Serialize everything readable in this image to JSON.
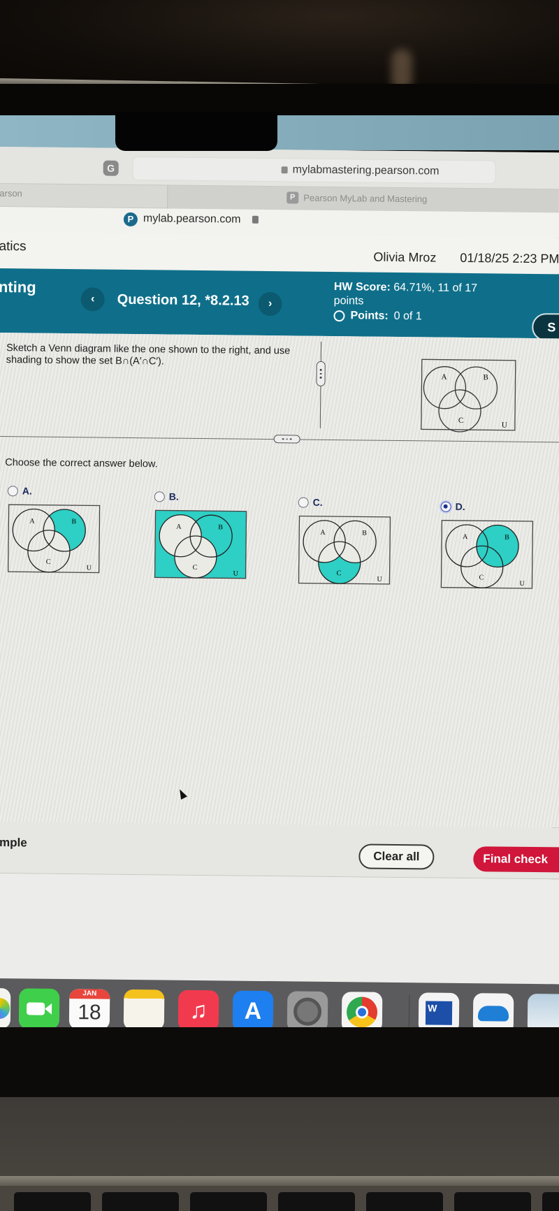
{
  "browser": {
    "address_url": "mylabmastering.pearson.com",
    "tabs": [
      {
        "label": "arson",
        "active": false
      },
      {
        "label": "Pearson MyLab and Mastering",
        "active": true,
        "favicon": "P"
      }
    ],
    "site_url": "mylab.pearson.com",
    "grammarly_icon": "G"
  },
  "header": {
    "course_fragment": "atics",
    "user_name": "Olivia Mroz",
    "timestamp": "01/18/25 2:23 PM"
  },
  "question_bar": {
    "section_fragment": "nting",
    "prev_label": "‹",
    "next_label": "›",
    "question_label": "Question 12, *8.2.13",
    "hw_score_label": "HW Score:",
    "hw_score_value": "64.71%, 11 of 17",
    "hw_score_suffix": "points",
    "points_label": "Points:",
    "points_value": "0 of 1",
    "side_button_label": "S"
  },
  "question": {
    "prompt": "Sketch a Venn diagram like the one shown to the right, and use shading to show the set B∩(A′∩C′).",
    "choose_label": "Choose the correct answer below.",
    "reference_venn": {
      "labels": [
        "A",
        "B",
        "C",
        "U"
      ],
      "shaded": "none"
    },
    "options": [
      {
        "letter": "A.",
        "selected": false,
        "shaded": "B only (B∩A′∩C′)"
      },
      {
        "letter": "B.",
        "selected": false,
        "shaded": "complement of (A∪C) plus B region outside A and C"
      },
      {
        "letter": "C.",
        "selected": false,
        "shaded": "C only (C∩A′∩B′)"
      },
      {
        "letter": "D.",
        "selected": true,
        "shaded": "all of B"
      }
    ],
    "venn_labels": {
      "a": "A",
      "b": "B",
      "c": "C",
      "u": "U"
    }
  },
  "actions": {
    "example_fragment": "ample",
    "clear_all": "Clear all",
    "final_check": "Final check"
  },
  "dock": {
    "items": [
      "photos-icon",
      "facetime-icon",
      "calendar-icon",
      "notes-icon",
      "music-icon",
      "app-store-icon",
      "system-settings-icon",
      "chrome-icon",
      "word-icon",
      "onedrive-icon",
      "preview-icon"
    ],
    "calendar_month": "JAN",
    "calendar_day": "18"
  },
  "colors": {
    "teal_header": "#0f6f8a",
    "venn_shade": "#2ecfc4",
    "final_check": "#d0163a"
  }
}
